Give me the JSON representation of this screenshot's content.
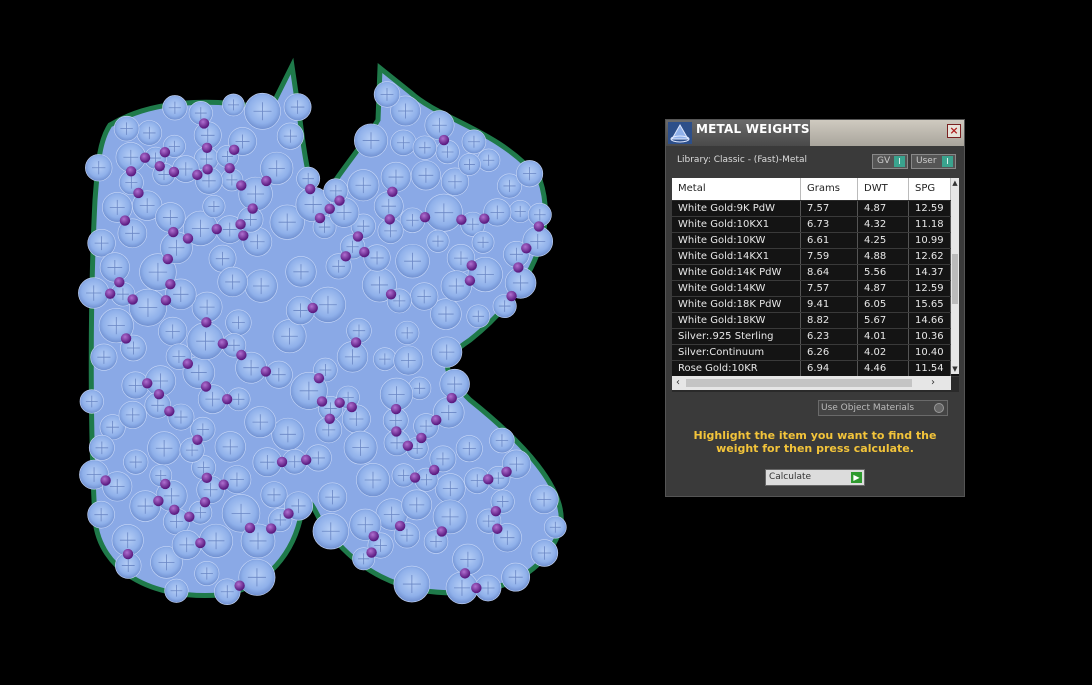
{
  "panel": {
    "title": "METAL WEIGHTS",
    "close_glyph": "×",
    "library_label": "Library: Classic - (Fast)-Metal",
    "toggles": [
      {
        "label": "GV",
        "indicator": "I"
      },
      {
        "label": "User",
        "indicator": "I"
      }
    ],
    "table": {
      "columns": [
        "Metal",
        "Grams",
        "DWT",
        "SPG"
      ],
      "rows": [
        [
          "White Gold:9K PdW",
          "7.57",
          "4.87",
          "12.59"
        ],
        [
          "White Gold:10KX1",
          "6.73",
          "4.32",
          "11.18"
        ],
        [
          "White Gold:10KW",
          "6.61",
          "4.25",
          "10.99"
        ],
        [
          "White Gold:14KX1",
          "7.59",
          "4.88",
          "12.62"
        ],
        [
          "White Gold:14K PdW",
          "8.64",
          "5.56",
          "14.37"
        ],
        [
          "White Gold:14KW",
          "7.57",
          "4.87",
          "12.59"
        ],
        [
          "White Gold:18K PdW",
          "9.41",
          "6.05",
          "15.65"
        ],
        [
          "White Gold:18KW",
          "8.82",
          "5.67",
          "14.66"
        ],
        [
          "Silver:.925 Sterling",
          "6.23",
          "4.01",
          "10.36"
        ],
        [
          "Silver:Continuum",
          "6.26",
          "4.02",
          "10.40"
        ],
        [
          "Rose Gold:10KR",
          "6.94",
          "4.46",
          "11.54"
        ]
      ]
    },
    "use_object_materials": "Use Object Materials",
    "hint": "Highlight the item you want to find the weight for then press calculate.",
    "calculate_label": "Calculate",
    "calculate_glyph": "▶"
  },
  "colors": {
    "gem_fill": "#9ebcf0",
    "prong": "#7a2a9a",
    "outline": "#1f7a4a",
    "hint": "#f3c43a",
    "indicator": "#3aa38e"
  },
  "icons": [
    "shape-logo-icon",
    "close-icon",
    "toggle-indicator-icon",
    "radio-icon",
    "play-arrow-icon",
    "scroll-arrow-icon"
  ]
}
